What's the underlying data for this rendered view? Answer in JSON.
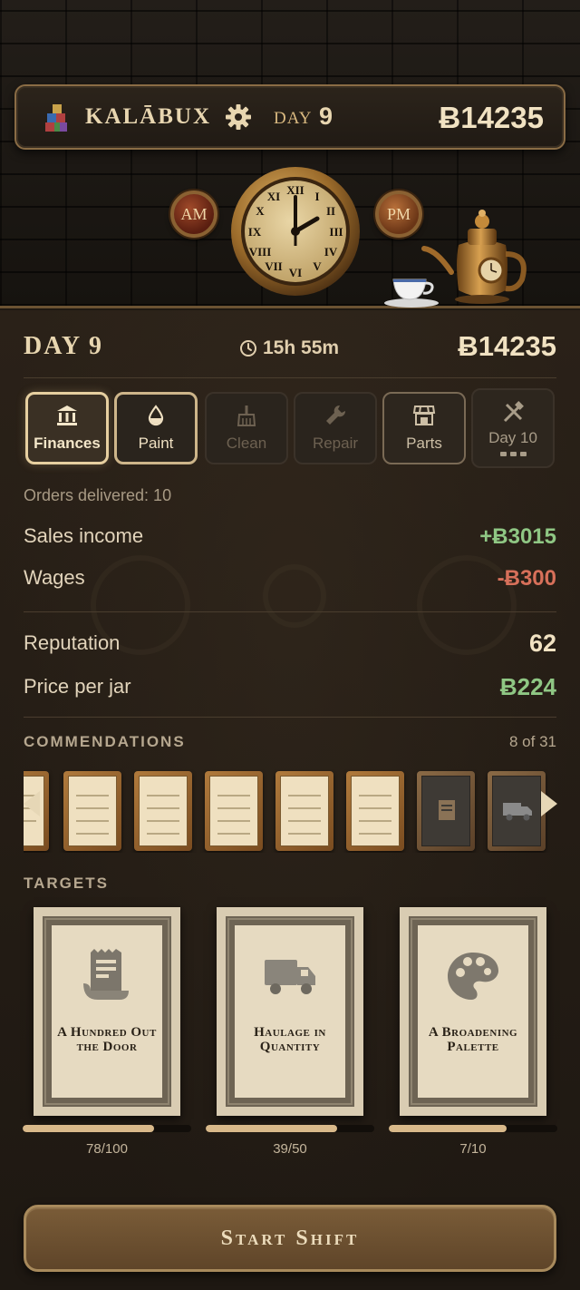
{
  "header": {
    "app_title": "KALĀBUX",
    "day_label": "DAY",
    "day_number": "9",
    "money": "Ƀ14235",
    "am_label": "AM",
    "pm_label": "PM",
    "icons": {
      "logo": "stacked-jars-logo",
      "settings": "gear-icon"
    }
  },
  "panel": {
    "day_heading": "DAY 9",
    "time_left": "15h 55m",
    "money": "Ƀ14235"
  },
  "tabs": [
    {
      "label": "Finances",
      "icon": "bank-icon",
      "state": "active"
    },
    {
      "label": "Paint",
      "icon": "paint-drop-icon",
      "state": "selected"
    },
    {
      "label": "Clean",
      "icon": "broom-icon",
      "state": "disabled"
    },
    {
      "label": "Repair",
      "icon": "wrench-icon",
      "state": "disabled"
    },
    {
      "label": "Parts",
      "icon": "shop-icon",
      "state": "enabled"
    },
    {
      "label": "Day 10",
      "icon": "tools-icon",
      "state": "disabled"
    }
  ],
  "finances": {
    "orders_delivered": "Orders delivered: 10",
    "sales_income_label": "Sales income",
    "sales_income_value": "+Ƀ3015",
    "wages_label": "Wages",
    "wages_value": "-Ƀ300",
    "reputation_label": "Reputation",
    "reputation_value": "62",
    "price_label": "Price per jar",
    "price_value": "Ƀ224"
  },
  "commendations": {
    "title": "COMMENDATIONS",
    "count": "8 of 31"
  },
  "targets": {
    "title": "TARGETS",
    "items": [
      {
        "name": "A Hundred Out the Door",
        "progress_text": "78/100",
        "progress": 0.78,
        "icon": "receipt-icon"
      },
      {
        "name": "Haulage in Quantity",
        "progress_text": "39/50",
        "progress": 0.78,
        "icon": "truck-icon"
      },
      {
        "name": "A Broadening Palette",
        "progress_text": "7/10",
        "progress": 0.7,
        "icon": "palette-icon"
      }
    ]
  },
  "start_button": "Start Shift",
  "colors": {
    "accent_gold": "#e6cfa0",
    "income_green": "#8fc784",
    "wages_red": "#d7705a",
    "background": "#1f1912"
  }
}
